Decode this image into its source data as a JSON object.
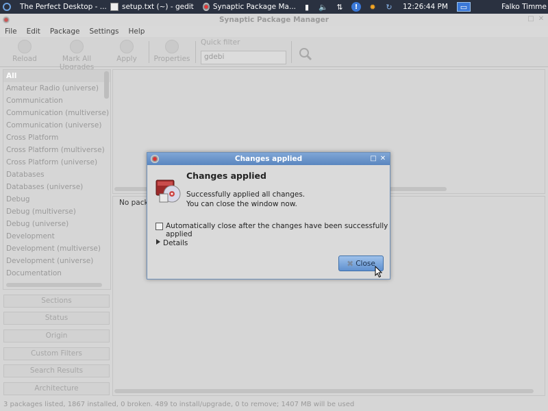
{
  "panel": {
    "tasks": [
      {
        "label": "The Perfect Desktop - ...",
        "icon": "firefox-icon"
      },
      {
        "label": "setup.txt (~) - gedit",
        "icon": "gedit-icon"
      },
      {
        "label": "Synaptic Package Ma...",
        "icon": "synaptic-icon"
      }
    ],
    "clock": "12:26:44 PM",
    "user": "Falko Timme"
  },
  "window": {
    "title": "Synaptic Package Manager"
  },
  "menubar": {
    "items": [
      "File",
      "Edit",
      "Package",
      "Settings",
      "Help"
    ]
  },
  "toolbar": {
    "reload": "Reload",
    "mark_all": "Mark All Upgrades",
    "apply": "Apply",
    "properties": "Properties",
    "quick_filter_label": "Quick filter",
    "quick_filter_value": "gdebi"
  },
  "sidebar": {
    "categories": [
      "All",
      "Amateur Radio (universe)",
      "Communication",
      "Communication (multiverse)",
      "Communication (universe)",
      "Cross Platform",
      "Cross Platform (multiverse)",
      "Cross Platform (universe)",
      "Databases",
      "Databases (universe)",
      "Debug",
      "Debug (multiverse)",
      "Debug (universe)",
      "Development",
      "Development (multiverse)",
      "Development (universe)",
      "Documentation"
    ],
    "selected": "All",
    "buttons": [
      "Sections",
      "Status",
      "Origin",
      "Custom Filters",
      "Search Results",
      "Architecture"
    ]
  },
  "detail": {
    "text": "No package"
  },
  "statusbar": {
    "text": "3 packages listed, 1867 installed, 0 broken. 489 to install/upgrade, 0 to remove; 1407 MB will be used"
  },
  "dialog": {
    "title": "Changes applied",
    "heading": "Changes applied",
    "message_line1": "Successfully applied all changes.",
    "message_line2": "You can close the window now.",
    "checkbox_label": "Automatically close after the changes have been successfully applied",
    "checkbox_checked": false,
    "details_label": "Details",
    "close_label": "Close"
  }
}
